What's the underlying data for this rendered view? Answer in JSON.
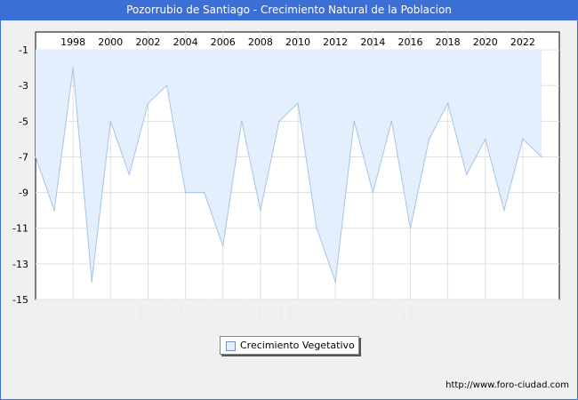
{
  "header": {
    "title": "Pozorrubio de Santiago - Crecimiento Natural de la Poblacion"
  },
  "watermark": "FORO-CIUDAD.COM",
  "footer": {
    "url": "http://www.foro-ciudad.com"
  },
  "colors": {
    "title_bg": "#3b6fd6",
    "area_fill": "#e3effc",
    "line": "#a6c4e6",
    "grid": "#e0e0e0",
    "watermark": "#f0f0f4"
  },
  "chart_data": {
    "type": "area",
    "title": "Pozorrubio de Santiago - Crecimiento Natural de la Poblacion",
    "x": [
      1996,
      1997,
      1998,
      1999,
      2000,
      2001,
      2002,
      2003,
      2004,
      2005,
      2006,
      2007,
      2008,
      2009,
      2010,
      2011,
      2012,
      2013,
      2014,
      2015,
      2016,
      2017,
      2018,
      2019,
      2020,
      2021,
      2022,
      2023
    ],
    "series": [
      {
        "name": "Crecimiento Vegetativo",
        "values": [
          -7,
          -10,
          -2,
          -14,
          -5,
          -8,
          -4,
          -3,
          -9,
          -9,
          -12,
          -5,
          -10,
          -5,
          -4,
          -11,
          -14,
          -5,
          -9,
          -5,
          -11,
          -6,
          -4,
          -8,
          -6,
          -10,
          -6,
          -7
        ]
      }
    ],
    "xticks": [
      "1998",
      "2000",
      "2002",
      "2004",
      "2006",
      "2008",
      "2010",
      "2012",
      "2014",
      "2016",
      "2018",
      "2020",
      "2022"
    ],
    "yticks": [
      "-1",
      "-3",
      "-5",
      "-7",
      "-9",
      "-11",
      "-13",
      "-15"
    ],
    "ylim": [
      -15,
      0
    ],
    "baseline": -1,
    "grid": true,
    "legend_position": "bottom-center"
  }
}
